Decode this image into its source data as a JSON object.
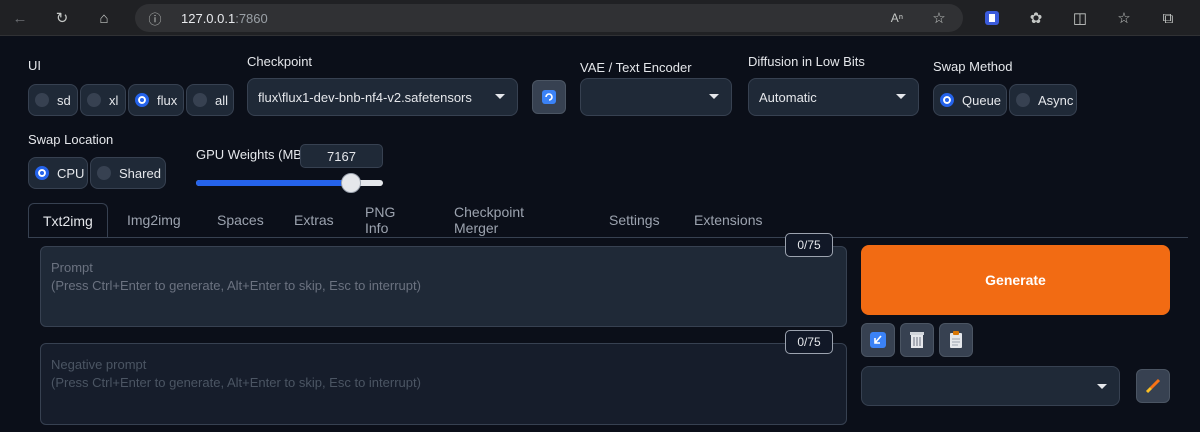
{
  "browser": {
    "url_host": "127.0.0.1",
    "url_port": ":7860"
  },
  "ui": {
    "label": "UI",
    "options": [
      "sd",
      "xl",
      "flux",
      "all"
    ],
    "selected": "flux"
  },
  "checkpoint": {
    "label": "Checkpoint",
    "value": "flux\\flux1-dev-bnb-nf4-v2.safetensors"
  },
  "vae": {
    "label": "VAE / Text Encoder",
    "value": ""
  },
  "diffusion": {
    "label": "Diffusion in Low Bits",
    "value": "Automatic"
  },
  "swap_method": {
    "label": "Swap Method",
    "options": [
      "Queue",
      "Async"
    ],
    "selected": "Queue"
  },
  "swap_location": {
    "label": "Swap Location",
    "options": [
      "CPU",
      "Shared"
    ],
    "selected": "CPU"
  },
  "gpu_weights": {
    "label": "GPU Weights (MB)",
    "value": "7167",
    "slider_fraction": 0.83
  },
  "tabs": [
    "Txt2img",
    "Img2img",
    "Spaces",
    "Extras",
    "PNG Info",
    "Checkpoint Merger",
    "Settings",
    "Extensions"
  ],
  "active_tab": "Txt2img",
  "prompt": {
    "label": "Prompt",
    "placeholder": "(Press Ctrl+Enter to generate, Alt+Enter to skip, Esc to interrupt)",
    "counter": "0/75"
  },
  "negative_prompt": {
    "label": "Negative prompt",
    "placeholder": "(Press Ctrl+Enter to generate, Alt+Enter to skip, Esc to interrupt)",
    "counter": "0/75"
  },
  "generate": {
    "label": "Generate"
  },
  "styles": {
    "value": ""
  },
  "colors": {
    "accent": "#2563eb",
    "generate": "#f26b13",
    "background": "#0b0f19"
  }
}
